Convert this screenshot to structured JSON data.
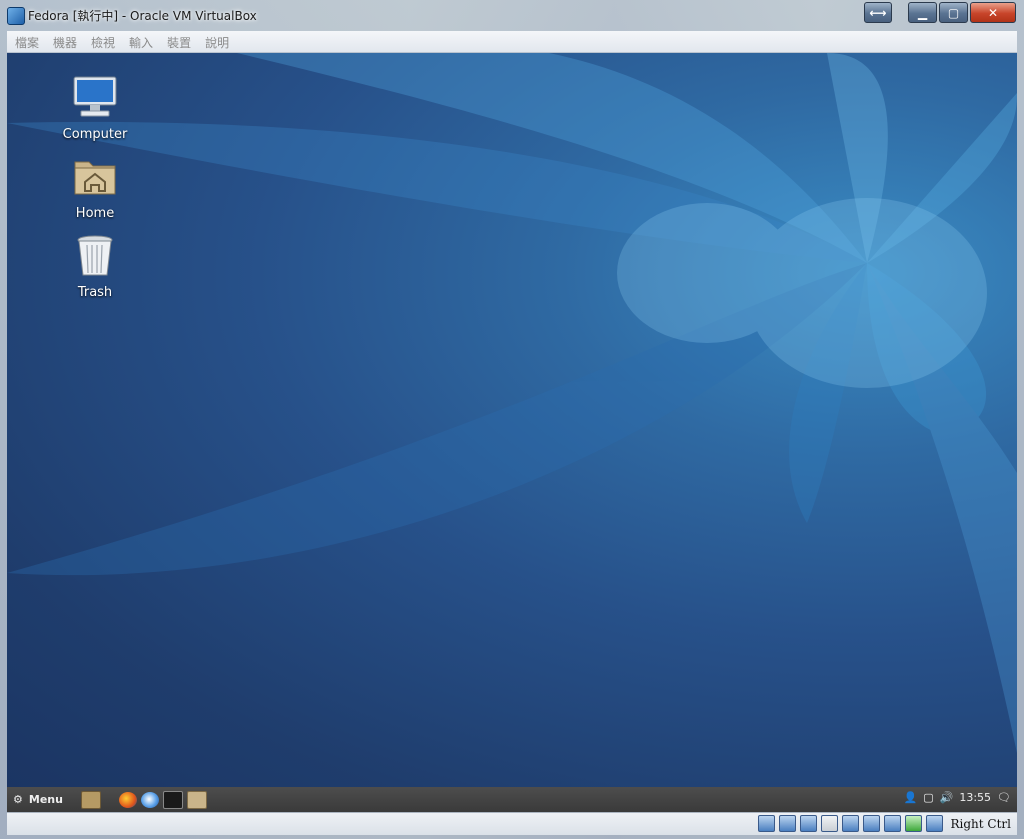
{
  "window": {
    "title": "Fedora [執行中] - Oracle VM VirtualBox",
    "buttons": [
      "switch",
      "minimize",
      "maximize",
      "close"
    ]
  },
  "menubar": {
    "items": [
      "檔案",
      "機器",
      "檢視",
      "輸入",
      "裝置",
      "說明"
    ]
  },
  "desktop": {
    "icons": [
      {
        "label": "Computer",
        "icon": "computer-icon"
      },
      {
        "label": "Home",
        "icon": "home-folder-icon"
      },
      {
        "label": "Trash",
        "icon": "trash-icon"
      }
    ]
  },
  "panel": {
    "menu_label": "Menu",
    "launchers": [
      "show-desktop-icon",
      "firefox-icon",
      "thunderbird-icon",
      "terminal-icon",
      "files-icon"
    ],
    "clock": "13:55",
    "tray_icons": [
      "user-icon",
      "network-icon",
      "volume-icon",
      "notifications-icon"
    ]
  },
  "statusbar": {
    "device_icons": [
      "optical-drive-icon",
      "usb-icon",
      "shared-clipboard-icon",
      "shared-folder-icon",
      "display-icon",
      "network-icon",
      "recording-icon",
      "cpu-icon",
      "mouse-integration-icon"
    ],
    "host_key": "Right Ctrl"
  },
  "colors": {
    "desktop_dark": "#1b3563",
    "desktop_light": "#3a8cc4",
    "panel": "#3f3f3f",
    "close_button": "#c8452a"
  }
}
